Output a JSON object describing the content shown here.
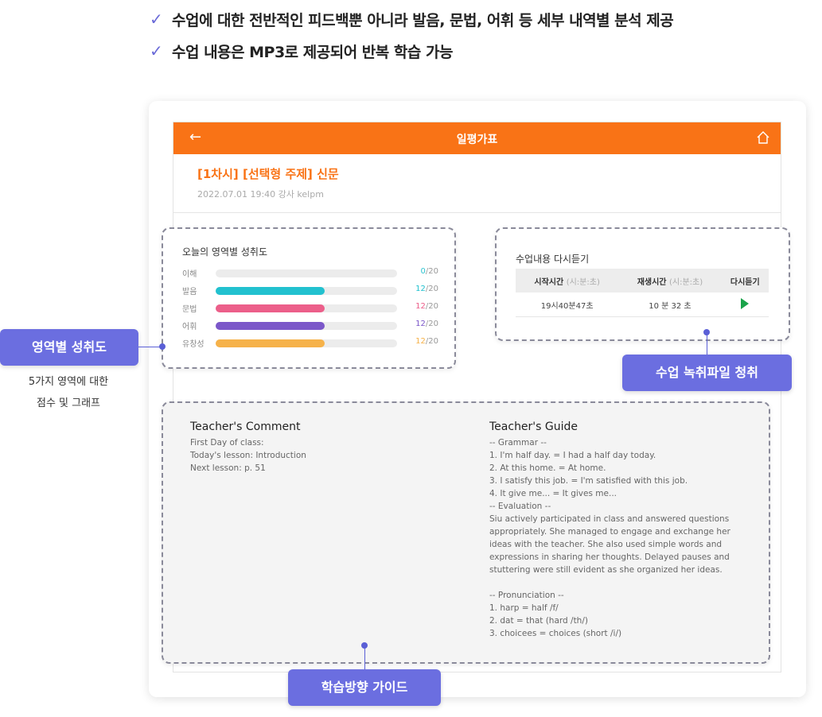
{
  "features": [
    "수업에 대한 전반적인 피드백뿐 아니라 발음, 문법, 어휘 등 세부 내역별 분석 제공",
    "수업 내용은 MP3로 제공되어 반복 학습 가능"
  ],
  "check_symbol": "✓",
  "app": {
    "title": "일평가표",
    "back_icon": "←",
    "lesson_title": "[1차시] [선택형 주제] 신문",
    "lesson_meta": "2022.07.01  19:40 강사 kelpm"
  },
  "scores": {
    "title": "오늘의 영역별 성취도",
    "max_label": "/20",
    "items": [
      {
        "label": "이해",
        "value": "0",
        "fraction": 0,
        "color": "#2ec4d0"
      },
      {
        "label": "발음",
        "value": "12",
        "fraction": 0.6,
        "color": "#22c1cf"
      },
      {
        "label": "문법",
        "value": "12",
        "fraction": 0.6,
        "color": "#ec5f8a"
      },
      {
        "label": "어휘",
        "value": "12",
        "fraction": 0.6,
        "color": "#7b57c9"
      },
      {
        "label": "유창성",
        "value": "12",
        "fraction": 0.6,
        "color": "#f6b24a"
      }
    ]
  },
  "replay": {
    "title": "수업내용 다시듣기",
    "headers": [
      {
        "text": "시작시간",
        "unit": "(시:분:초)"
      },
      {
        "text": "재생시간",
        "unit": "(시:분:초)"
      },
      {
        "text": "다시듣기",
        "unit": ""
      }
    ],
    "row": {
      "start": "19시40분47초",
      "duration": "10 분 32 초"
    }
  },
  "comment": {
    "title": "Teacher's Comment",
    "lines": [
      "First Day of class:",
      "Today's lesson: Introduction",
      "Next lesson: p. 51"
    ]
  },
  "guide": {
    "title": "Teacher's Guide",
    "lines": [
      "-- Grammar --",
      "1. I'm half day. = I had a half day today.",
      "2. At this home. = At home.",
      "3. I satisfy this job. = I'm satisfied with this job.",
      "4. It give me... = It gives me...",
      "-- Evaluation --",
      "Siu actively participated in class and answered questions",
      "appropriately. She managed to engage and exchange her",
      "ideas with the teacher. She also used simple words and",
      "expressions in sharing her thoughts. Delayed pauses and",
      "stuttering were still evident as she organized her ideas.",
      " ",
      "-- Pronunciation --",
      "1. harp = half /f/",
      "2. dat = that (hard /th/)",
      "3. choicees = choices (short /i/)"
    ]
  },
  "labels": {
    "score_pill": "영역별 성취도",
    "score_caption_1": "5가지 영역에 대한",
    "score_caption_2": "점수 및 그래프",
    "replay_pill": "수업 녹취파일 청취",
    "guide_pill": "학습방향 가이드"
  },
  "colors": {
    "brand_orange": "#f97316",
    "accent_purple": "#6b6ee0",
    "play_green": "#1aa34a"
  }
}
